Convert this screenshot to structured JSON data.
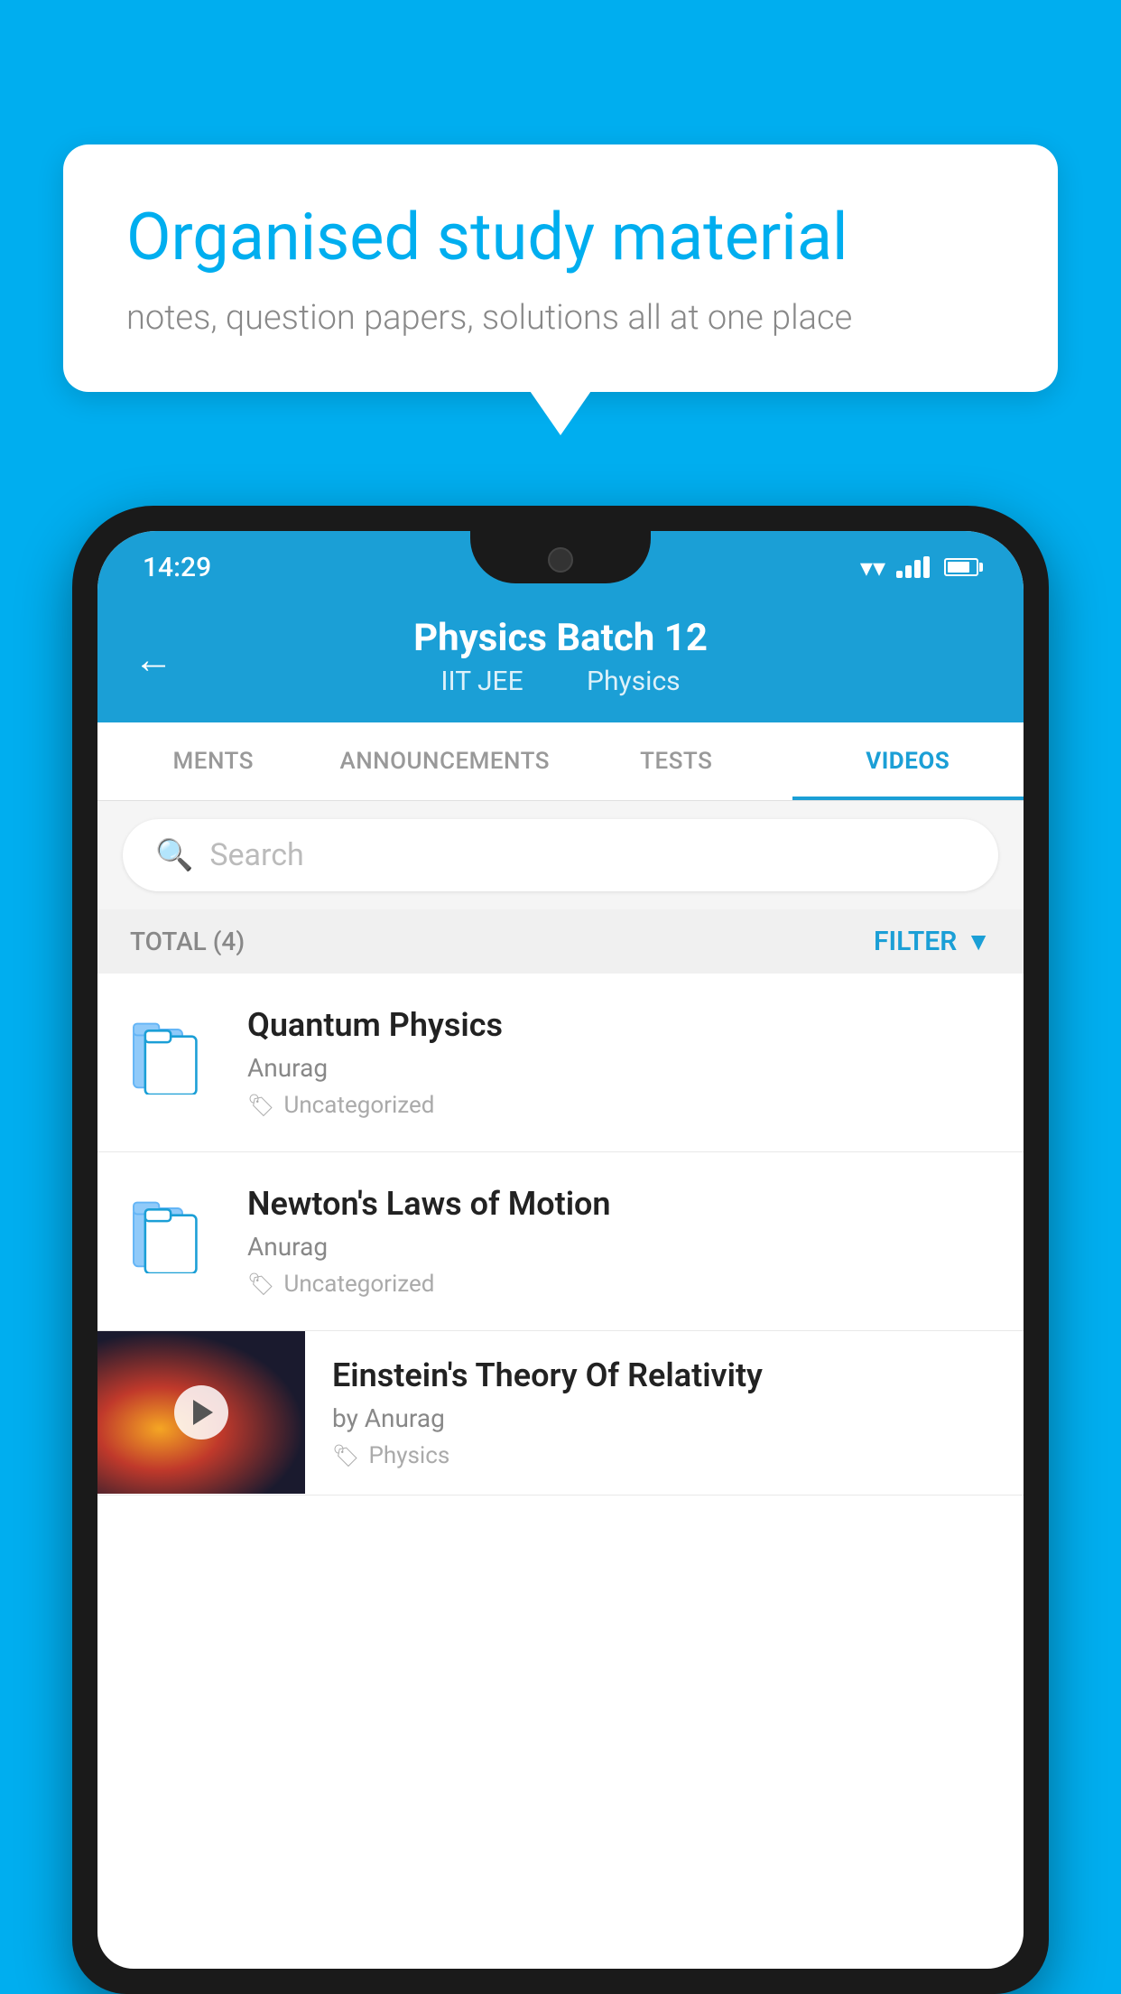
{
  "background_color": "#00AEEF",
  "bubble": {
    "title": "Organised study material",
    "subtitle": "notes, question papers, solutions all at one place"
  },
  "status_bar": {
    "time": "14:29"
  },
  "header": {
    "title": "Physics Batch 12",
    "subtitle_tag1": "IIT JEE",
    "subtitle_tag2": "Physics"
  },
  "tabs": [
    {
      "label": "MENTS",
      "active": false
    },
    {
      "label": "ANNOUNCEMENTS",
      "active": false
    },
    {
      "label": "TESTS",
      "active": false
    },
    {
      "label": "VIDEOS",
      "active": true
    }
  ],
  "search": {
    "placeholder": "Search"
  },
  "filter_bar": {
    "total_label": "TOTAL (4)",
    "filter_label": "FILTER"
  },
  "videos": [
    {
      "title": "Quantum Physics",
      "author": "Anurag",
      "tag": "Uncategorized",
      "has_thumbnail": false
    },
    {
      "title": "Newton's Laws of Motion",
      "author": "Anurag",
      "tag": "Uncategorized",
      "has_thumbnail": false
    },
    {
      "title": "Einstein's Theory Of Relativity",
      "author": "by Anurag",
      "tag": "Physics",
      "has_thumbnail": true
    }
  ]
}
